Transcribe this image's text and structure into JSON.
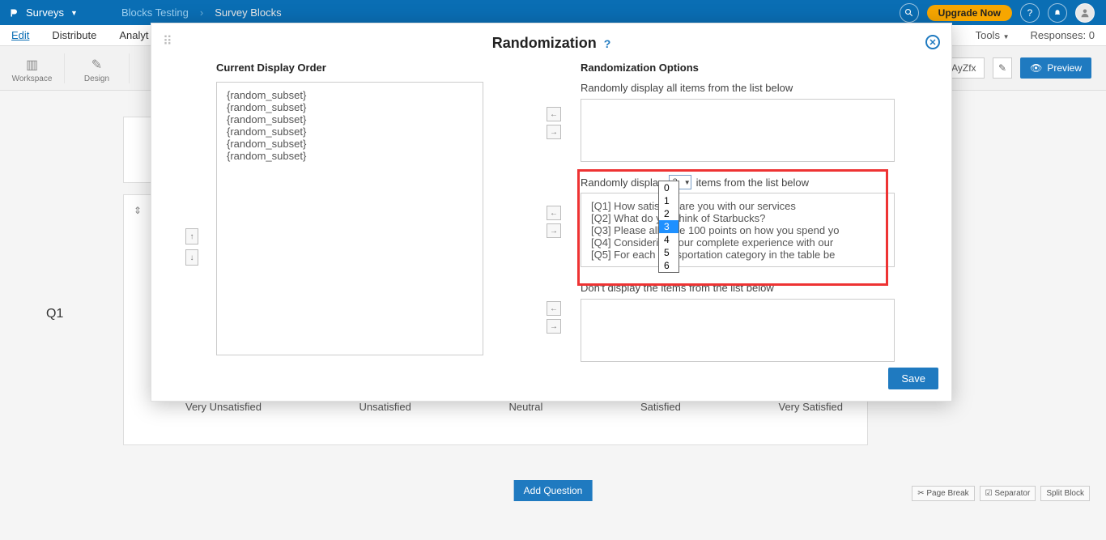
{
  "topbar": {
    "brand": "Surveys",
    "crumb1": "Blocks Testing",
    "crumb_sep": "›",
    "crumb2": "Survey Blocks",
    "upgrade": "Upgrade Now"
  },
  "tabs": {
    "edit": "Edit",
    "distribute": "Distribute",
    "analytics": "Analyt",
    "tools": "Tools",
    "responses": "Responses: 0"
  },
  "toolbar": {
    "workspace": "Workspace",
    "design": "Design",
    "url_value": "t/AOXAyZfx",
    "preview": "Preview"
  },
  "survey": {
    "q_label": "Q1",
    "scale": [
      "Very Unsatisfied",
      "Unsatisfied",
      "Neutral",
      "Satisfied",
      "Very Satisfied"
    ],
    "add_question": "Add Question",
    "page_break": "Page Break",
    "separator": "Separator",
    "split_block": "Split Block"
  },
  "modal": {
    "title": "Randomization",
    "left_heading": "Current Display Order",
    "right_heading": "Randomization Options",
    "display_all": "Randomly display all items from the list below",
    "rand_prefix": "Randomly display",
    "rand_suffix": "items from the list below",
    "dont_display": "Don't display the items from the list below",
    "save": "Save",
    "selected_count": "3",
    "display_items": [
      "{random_subset}",
      "{random_subset}",
      "{random_subset}",
      "{random_subset}",
      "{random_subset}",
      "{random_subset}"
    ],
    "questions": [
      "[Q1] How satisfied are you with our services",
      "[Q2] What do you think of Starbucks?",
      "[Q3] Please allocate 100 points on how you spend yo",
      "[Q4] Considering your complete experience with our",
      "[Q5] For each transportation category in the table be"
    ],
    "dropdown_options": [
      "0",
      "1",
      "2",
      "3",
      "4",
      "5",
      "6"
    ]
  }
}
